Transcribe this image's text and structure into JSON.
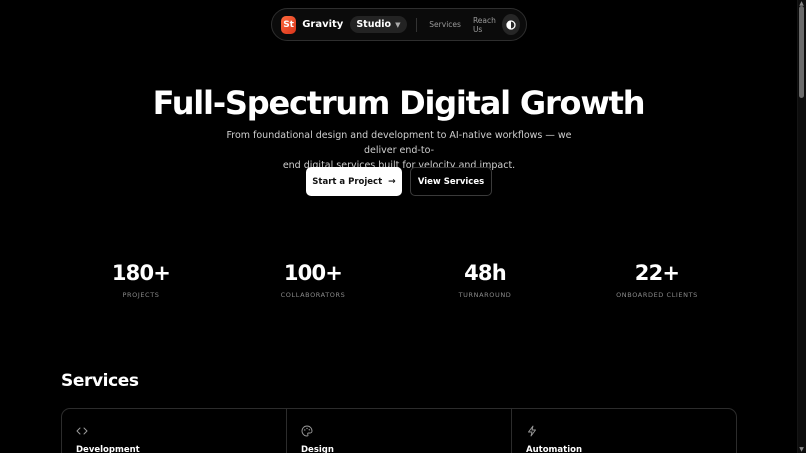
{
  "nav": {
    "logo_text": "St",
    "brand": "Gravity",
    "studio_label": "Studio",
    "links": [
      "Services",
      "Reach Us"
    ],
    "theme_toggle_icon": "contrast-icon",
    "accent": "#ff5a2e"
  },
  "hero": {
    "title": "Full-Spectrum Digital Growth",
    "subtitle_line1": "From foundational design and development to AI-native workflows — we deliver end-to-",
    "subtitle_line2": "end digital services built for velocity and impact.",
    "primary_cta": "Start a Project",
    "secondary_cta": "View Services"
  },
  "stats": [
    {
      "value": "180+",
      "label": "PROJECTS"
    },
    {
      "value": "100+",
      "label": "COLLABORATORS"
    },
    {
      "value": "48h",
      "label": "TURNAROUND"
    },
    {
      "value": "22+",
      "label": "ONBOARDED CLIENTS"
    }
  ],
  "services": {
    "heading": "Services",
    "cards": [
      {
        "title": "Development",
        "icon": "code-icon"
      },
      {
        "title": "Design",
        "icon": "palette-icon"
      },
      {
        "title": "Automation",
        "icon": "lightning-icon"
      }
    ]
  }
}
